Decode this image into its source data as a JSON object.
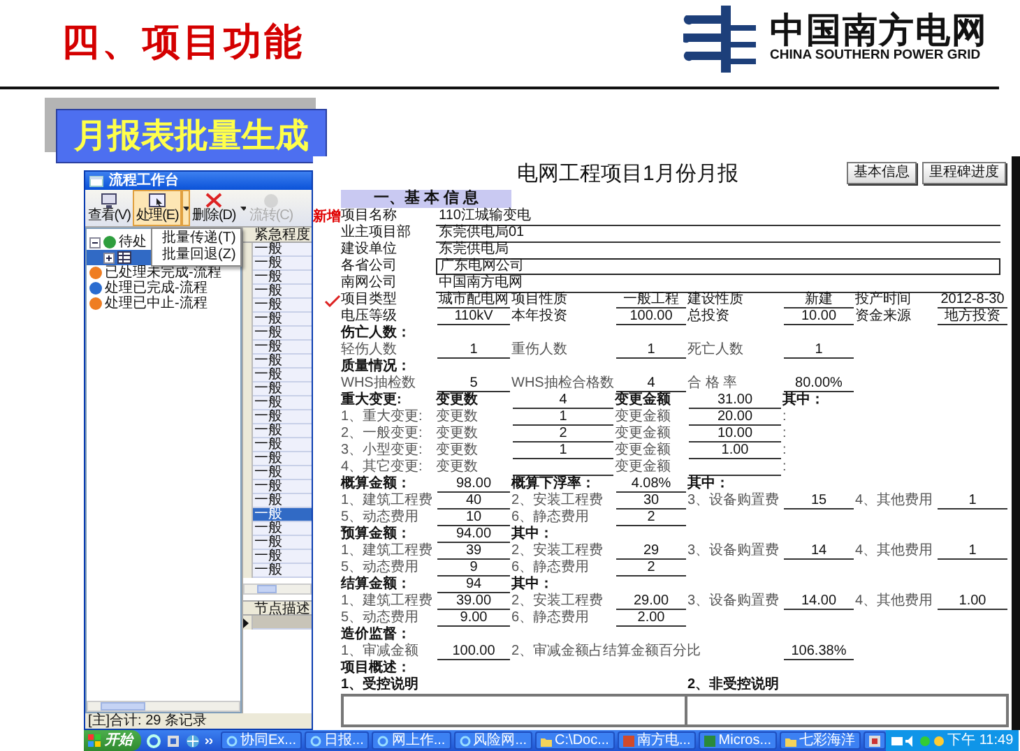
{
  "slide": {
    "title": "四、项目功能",
    "logo": {
      "name": "中国南方电网",
      "subtitle": "CHINA SOUTHERN POWER GRID"
    },
    "banner": "月报表批量生成"
  },
  "workbench": {
    "title": "流程工作台",
    "toolbar": [
      {
        "label": "查看(V)",
        "kind": "view",
        "pressed": false,
        "disabled": false,
        "dropdown": false
      },
      {
        "label": "处理(E)",
        "kind": "process",
        "pressed": true,
        "disabled": false,
        "dropdown": true
      },
      {
        "label": "删除(D)",
        "kind": "delete",
        "pressed": false,
        "disabled": false,
        "dropdown": true
      },
      {
        "label": "流转(C)",
        "kind": "forward",
        "pressed": false,
        "disabled": true,
        "dropdown": false
      }
    ],
    "menu": [
      {
        "label": "批量传递(T)"
      },
      {
        "label": "批量回退(Z)"
      }
    ],
    "tree": [
      {
        "label": "待处",
        "color": "#2e9e3e",
        "expanded": true,
        "selected": false,
        "children": [
          {
            "expanded": false,
            "selected": true
          }
        ]
      },
      {
        "label": "已处理未完成-流程",
        "color": "#ef7d22",
        "selected": false
      },
      {
        "label": "处理已完成-流程",
        "color": "#2a6cd0",
        "selected": false
      },
      {
        "label": "处理已中止-流程",
        "color": "#ef7d22",
        "selected": false
      }
    ],
    "grid": {
      "column": "紧急程度",
      "rows": [
        {
          "text": "一般",
          "selected": false
        },
        {
          "text": "一般",
          "selected": false
        },
        {
          "text": "一般",
          "selected": false
        },
        {
          "text": "一般",
          "selected": false
        },
        {
          "text": "一般",
          "selected": false
        },
        {
          "text": "一般",
          "selected": false
        },
        {
          "text": "一般",
          "selected": false
        },
        {
          "text": "一般",
          "selected": false
        },
        {
          "text": "一般",
          "selected": false
        },
        {
          "text": "一般",
          "selected": false
        },
        {
          "text": "一般",
          "selected": false
        },
        {
          "text": "一般",
          "selected": false
        },
        {
          "text": "一般",
          "selected": false
        },
        {
          "text": "一般",
          "selected": false
        },
        {
          "text": "一般",
          "selected": false
        },
        {
          "text": "一般",
          "selected": false
        },
        {
          "text": "一般",
          "selected": false
        },
        {
          "text": "一般",
          "selected": false
        },
        {
          "text": "一般",
          "selected": false
        },
        {
          "text": "一般",
          "selected": true
        },
        {
          "text": "一般",
          "selected": false
        },
        {
          "text": "一般",
          "selected": false
        },
        {
          "text": "一般",
          "selected": false
        },
        {
          "text": "一般",
          "selected": false
        }
      ]
    },
    "detail": {
      "column": "节点描述"
    },
    "status": "[主]合计: 29 条记录"
  },
  "form": {
    "title": "电网工程项目1月份月报",
    "buttons": [
      {
        "label": "基本信息"
      },
      {
        "label": "里程碑进度"
      }
    ],
    "section": "一、基 本 信 息",
    "rows": [
      {
        "kind": "field",
        "marker": {
          "kind": "text",
          "text": "新增"
        },
        "label": "项目名称",
        "value": "110江城输变电",
        "focused": false
      },
      {
        "kind": "field",
        "label": "业主项目部",
        "value": "东莞供电局01",
        "focused": false
      },
      {
        "kind": "field",
        "label": "建设单位",
        "value": "东莞供电局",
        "focused": false
      },
      {
        "kind": "field",
        "label": "各省公司",
        "value": "广东电网公司",
        "focused": true
      },
      {
        "kind": "field",
        "label": "南网公司",
        "value": "中国南方电网",
        "focused": false
      },
      {
        "kind": "grid",
        "marker": {
          "kind": "check"
        },
        "cells": [
          {
            "kind": "label",
            "text": "项目类型"
          },
          {
            "kind": "value",
            "text": "城市配电网"
          },
          {
            "kind": "label",
            "text": "项目性质"
          },
          {
            "kind": "value",
            "text": "一般工程"
          },
          {
            "kind": "label",
            "text": "建设性质"
          },
          {
            "kind": "value",
            "text": "新建"
          },
          {
            "kind": "label",
            "text": "投产时间"
          },
          {
            "kind": "value",
            "text": "2012-8-30"
          }
        ]
      },
      {
        "kind": "grid",
        "cells": [
          {
            "kind": "label",
            "text": "电压等级"
          },
          {
            "kind": "value",
            "text": "110kV"
          },
          {
            "kind": "label",
            "text": "本年投资"
          },
          {
            "kind": "value",
            "text": "100.00"
          },
          {
            "kind": "label",
            "text": "总投资"
          },
          {
            "kind": "value",
            "text": "10.00"
          },
          {
            "kind": "label",
            "text": "资金来源"
          },
          {
            "kind": "value",
            "text": "地方投资"
          }
        ]
      },
      {
        "kind": "heading",
        "label": "伤亡人数："
      },
      {
        "kind": "grid",
        "cells": [
          {
            "kind": "note",
            "text": "轻伤人数"
          },
          {
            "kind": "value",
            "text": "1"
          },
          {
            "kind": "note",
            "text": "重伤人数"
          },
          {
            "kind": "value",
            "text": "1"
          },
          {
            "kind": "note",
            "text": "死亡人数"
          },
          {
            "kind": "value",
            "text": "1"
          }
        ]
      },
      {
        "kind": "heading",
        "label": "质量情况："
      },
      {
        "kind": "grid",
        "cells": [
          {
            "kind": "note",
            "text": "WHS抽检数"
          },
          {
            "kind": "value",
            "text": "5"
          },
          {
            "kind": "note",
            "text": "WHS抽检合格数"
          },
          {
            "kind": "value",
            "text": "4"
          },
          {
            "kind": "note",
            "text": "合 格 率"
          },
          {
            "kind": "value",
            "text": "80.00%"
          }
        ]
      },
      {
        "kind": "grid",
        "cells": [
          {
            "kind": "strong",
            "text": "重大变更:"
          },
          {
            "kind": "strong",
            "text": "变更数"
          },
          {
            "kind": "value",
            "text": "4"
          },
          {
            "kind": "strong",
            "text": "变更金额"
          },
          {
            "kind": "value",
            "text": "31.00"
          },
          {
            "kind": "strong",
            "text": "其中："
          }
        ]
      },
      {
        "kind": "grid",
        "cells": [
          {
            "kind": "note",
            "text": "1、重大变更:"
          },
          {
            "kind": "note",
            "text": "变更数"
          },
          {
            "kind": "value",
            "text": "1"
          },
          {
            "kind": "note",
            "text": "变更金额"
          },
          {
            "kind": "value",
            "text": "20.00"
          },
          {
            "kind": "note",
            "text": ":"
          }
        ]
      },
      {
        "kind": "grid",
        "cells": [
          {
            "kind": "note",
            "text": "2、一般变更:"
          },
          {
            "kind": "note",
            "text": "变更数"
          },
          {
            "kind": "value",
            "text": "2"
          },
          {
            "kind": "note",
            "text": "变更金额"
          },
          {
            "kind": "value",
            "text": "10.00"
          },
          {
            "kind": "note",
            "text": ":"
          }
        ]
      },
      {
        "kind": "grid",
        "cells": [
          {
            "kind": "note",
            "text": "3、小型变更:"
          },
          {
            "kind": "note",
            "text": "变更数"
          },
          {
            "kind": "value",
            "text": "1"
          },
          {
            "kind": "note",
            "text": "变更金额"
          },
          {
            "kind": "value",
            "text": "1.00"
          },
          {
            "kind": "note",
            "text": ":"
          }
        ]
      },
      {
        "kind": "grid",
        "cells": [
          {
            "kind": "note",
            "text": "4、其它变更:"
          },
          {
            "kind": "note",
            "text": "变更数"
          },
          {
            "kind": "value"
          },
          {
            "kind": "note",
            "text": "变更金额"
          },
          {
            "kind": "value"
          },
          {
            "kind": "note",
            "text": ":"
          }
        ]
      },
      {
        "kind": "grid",
        "cells": [
          {
            "kind": "strong",
            "text": "概算金额："
          },
          {
            "kind": "value",
            "text": "98.00"
          },
          {
            "kind": "strong",
            "text": "概算下浮率："
          },
          {
            "kind": "value",
            "text": "4.08%"
          },
          {
            "kind": "strong",
            "text": "其中："
          }
        ]
      },
      {
        "kind": "grid",
        "cells": [
          {
            "kind": "note",
            "text": "1、建筑工程费"
          },
          {
            "kind": "value",
            "text": "40"
          },
          {
            "kind": "note",
            "text": "2、安装工程费"
          },
          {
            "kind": "value",
            "text": "30"
          },
          {
            "kind": "note",
            "text": "3、设备购置费"
          },
          {
            "kind": "value",
            "text": "15"
          },
          {
            "kind": "note",
            "text": "4、其他费用"
          },
          {
            "kind": "value",
            "text": "1"
          }
        ]
      },
      {
        "kind": "grid",
        "cells": [
          {
            "kind": "note",
            "text": "5、动态费用"
          },
          {
            "kind": "value",
            "text": "10"
          },
          {
            "kind": "note",
            "text": "6、静态费用"
          },
          {
            "kind": "value",
            "text": "2"
          }
        ]
      },
      {
        "kind": "grid",
        "cells": [
          {
            "kind": "strong",
            "text": "预算金额："
          },
          {
            "kind": "value",
            "text": "94.00"
          },
          {
            "kind": "strong",
            "text": "其中："
          }
        ]
      },
      {
        "kind": "grid",
        "cells": [
          {
            "kind": "note",
            "text": "1、建筑工程费"
          },
          {
            "kind": "value",
            "text": "39"
          },
          {
            "kind": "note",
            "text": "2、安装工程费"
          },
          {
            "kind": "value",
            "text": "29"
          },
          {
            "kind": "note",
            "text": "3、设备购置费"
          },
          {
            "kind": "value",
            "text": "14"
          },
          {
            "kind": "note",
            "text": "4、其他费用"
          },
          {
            "kind": "value",
            "text": "1"
          }
        ]
      },
      {
        "kind": "grid",
        "cells": [
          {
            "kind": "note",
            "text": "5、动态费用"
          },
          {
            "kind": "value",
            "text": "9"
          },
          {
            "kind": "note",
            "text": "6、静态费用"
          },
          {
            "kind": "value",
            "text": "2"
          }
        ]
      },
      {
        "kind": "grid",
        "cells": [
          {
            "kind": "strong",
            "text": "结算金额："
          },
          {
            "kind": "value",
            "text": "94"
          },
          {
            "kind": "strong",
            "text": "其中："
          }
        ]
      },
      {
        "kind": "grid",
        "cells": [
          {
            "kind": "note",
            "text": "1、建筑工程费"
          },
          {
            "kind": "value",
            "text": "39.00"
          },
          {
            "kind": "note",
            "text": "2、安装工程费"
          },
          {
            "kind": "value",
            "text": "29.00"
          },
          {
            "kind": "note",
            "text": "3、设备购置费"
          },
          {
            "kind": "value",
            "text": "14.00"
          },
          {
            "kind": "note",
            "text": "4、其他费用"
          },
          {
            "kind": "value",
            "text": "1.00"
          }
        ]
      },
      {
        "kind": "grid",
        "cells": [
          {
            "kind": "note",
            "text": "5、动态费用"
          },
          {
            "kind": "value",
            "text": "9.00"
          },
          {
            "kind": "note",
            "text": "6、静态费用"
          },
          {
            "kind": "value",
            "text": "2.00"
          }
        ]
      },
      {
        "kind": "heading",
        "label": "造价监督："
      },
      {
        "kind": "grid",
        "cells": [
          {
            "kind": "note",
            "text": "1、审减金额"
          },
          {
            "kind": "value",
            "text": "100.00"
          },
          {
            "kind": "long_note",
            "text": "2、审减金额占结算金额百分比"
          },
          {
            "kind": "value",
            "text": "106.38%"
          }
        ]
      },
      {
        "kind": "heading",
        "label": "项目概述："
      },
      {
        "kind": "notes",
        "items": [
          {
            "label": "1、受控说明"
          },
          {
            "label": "2、非受控说明"
          }
        ]
      }
    ]
  },
  "taskbar": {
    "start": "开始",
    "tasks": [
      {
        "label": "协同Ex...",
        "kind": "ie"
      },
      {
        "label": "日报...",
        "kind": "ie"
      },
      {
        "label": "网上作...",
        "kind": "ie"
      },
      {
        "label": "风险网...",
        "kind": "ie"
      },
      {
        "label": "C:\\Doc...",
        "kind": "folder"
      },
      {
        "label": "南方电...",
        "kind": "ppt"
      },
      {
        "label": "Micros...",
        "kind": "excel"
      },
      {
        "label": "七彩海洋",
        "kind": "folder"
      },
      {
        "kind": "app"
      }
    ],
    "clock": "下午 11:49"
  }
}
